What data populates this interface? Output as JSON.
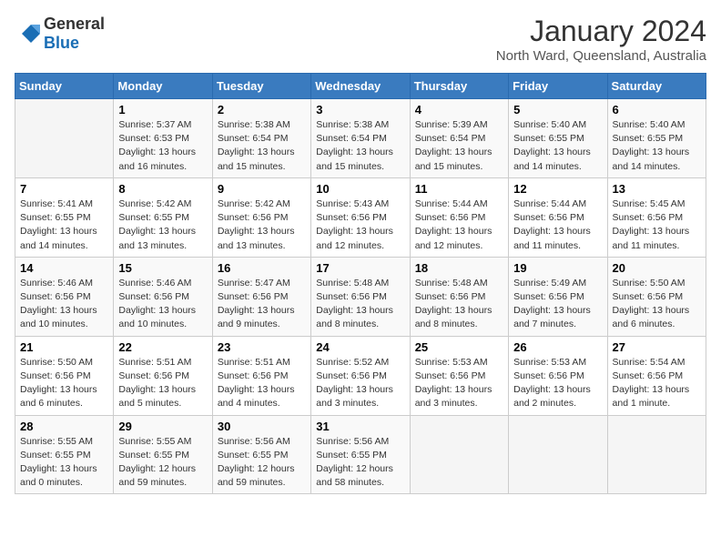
{
  "header": {
    "logo_general": "General",
    "logo_blue": "Blue",
    "title": "January 2024",
    "subtitle": "North Ward, Queensland, Australia"
  },
  "weekdays": [
    "Sunday",
    "Monday",
    "Tuesday",
    "Wednesday",
    "Thursday",
    "Friday",
    "Saturday"
  ],
  "weeks": [
    [
      {
        "day": "",
        "info": ""
      },
      {
        "day": "1",
        "info": "Sunrise: 5:37 AM\nSunset: 6:53 PM\nDaylight: 13 hours\nand 16 minutes."
      },
      {
        "day": "2",
        "info": "Sunrise: 5:38 AM\nSunset: 6:54 PM\nDaylight: 13 hours\nand 15 minutes."
      },
      {
        "day": "3",
        "info": "Sunrise: 5:38 AM\nSunset: 6:54 PM\nDaylight: 13 hours\nand 15 minutes."
      },
      {
        "day": "4",
        "info": "Sunrise: 5:39 AM\nSunset: 6:54 PM\nDaylight: 13 hours\nand 15 minutes."
      },
      {
        "day": "5",
        "info": "Sunrise: 5:40 AM\nSunset: 6:55 PM\nDaylight: 13 hours\nand 14 minutes."
      },
      {
        "day": "6",
        "info": "Sunrise: 5:40 AM\nSunset: 6:55 PM\nDaylight: 13 hours\nand 14 minutes."
      }
    ],
    [
      {
        "day": "7",
        "info": "Sunrise: 5:41 AM\nSunset: 6:55 PM\nDaylight: 13 hours\nand 14 minutes."
      },
      {
        "day": "8",
        "info": "Sunrise: 5:42 AM\nSunset: 6:55 PM\nDaylight: 13 hours\nand 13 minutes."
      },
      {
        "day": "9",
        "info": "Sunrise: 5:42 AM\nSunset: 6:56 PM\nDaylight: 13 hours\nand 13 minutes."
      },
      {
        "day": "10",
        "info": "Sunrise: 5:43 AM\nSunset: 6:56 PM\nDaylight: 13 hours\nand 12 minutes."
      },
      {
        "day": "11",
        "info": "Sunrise: 5:44 AM\nSunset: 6:56 PM\nDaylight: 13 hours\nand 12 minutes."
      },
      {
        "day": "12",
        "info": "Sunrise: 5:44 AM\nSunset: 6:56 PM\nDaylight: 13 hours\nand 11 minutes."
      },
      {
        "day": "13",
        "info": "Sunrise: 5:45 AM\nSunset: 6:56 PM\nDaylight: 13 hours\nand 11 minutes."
      }
    ],
    [
      {
        "day": "14",
        "info": "Sunrise: 5:46 AM\nSunset: 6:56 PM\nDaylight: 13 hours\nand 10 minutes."
      },
      {
        "day": "15",
        "info": "Sunrise: 5:46 AM\nSunset: 6:56 PM\nDaylight: 13 hours\nand 10 minutes."
      },
      {
        "day": "16",
        "info": "Sunrise: 5:47 AM\nSunset: 6:56 PM\nDaylight: 13 hours\nand 9 minutes."
      },
      {
        "day": "17",
        "info": "Sunrise: 5:48 AM\nSunset: 6:56 PM\nDaylight: 13 hours\nand 8 minutes."
      },
      {
        "day": "18",
        "info": "Sunrise: 5:48 AM\nSunset: 6:56 PM\nDaylight: 13 hours\nand 8 minutes."
      },
      {
        "day": "19",
        "info": "Sunrise: 5:49 AM\nSunset: 6:56 PM\nDaylight: 13 hours\nand 7 minutes."
      },
      {
        "day": "20",
        "info": "Sunrise: 5:50 AM\nSunset: 6:56 PM\nDaylight: 13 hours\nand 6 minutes."
      }
    ],
    [
      {
        "day": "21",
        "info": "Sunrise: 5:50 AM\nSunset: 6:56 PM\nDaylight: 13 hours\nand 6 minutes."
      },
      {
        "day": "22",
        "info": "Sunrise: 5:51 AM\nSunset: 6:56 PM\nDaylight: 13 hours\nand 5 minutes."
      },
      {
        "day": "23",
        "info": "Sunrise: 5:51 AM\nSunset: 6:56 PM\nDaylight: 13 hours\nand 4 minutes."
      },
      {
        "day": "24",
        "info": "Sunrise: 5:52 AM\nSunset: 6:56 PM\nDaylight: 13 hours\nand 3 minutes."
      },
      {
        "day": "25",
        "info": "Sunrise: 5:53 AM\nSunset: 6:56 PM\nDaylight: 13 hours\nand 3 minutes."
      },
      {
        "day": "26",
        "info": "Sunrise: 5:53 AM\nSunset: 6:56 PM\nDaylight: 13 hours\nand 2 minutes."
      },
      {
        "day": "27",
        "info": "Sunrise: 5:54 AM\nSunset: 6:56 PM\nDaylight: 13 hours\nand 1 minute."
      }
    ],
    [
      {
        "day": "28",
        "info": "Sunrise: 5:55 AM\nSunset: 6:55 PM\nDaylight: 13 hours\nand 0 minutes."
      },
      {
        "day": "29",
        "info": "Sunrise: 5:55 AM\nSunset: 6:55 PM\nDaylight: 12 hours\nand 59 minutes."
      },
      {
        "day": "30",
        "info": "Sunrise: 5:56 AM\nSunset: 6:55 PM\nDaylight: 12 hours\nand 59 minutes."
      },
      {
        "day": "31",
        "info": "Sunrise: 5:56 AM\nSunset: 6:55 PM\nDaylight: 12 hours\nand 58 minutes."
      },
      {
        "day": "",
        "info": ""
      },
      {
        "day": "",
        "info": ""
      },
      {
        "day": "",
        "info": ""
      }
    ]
  ]
}
